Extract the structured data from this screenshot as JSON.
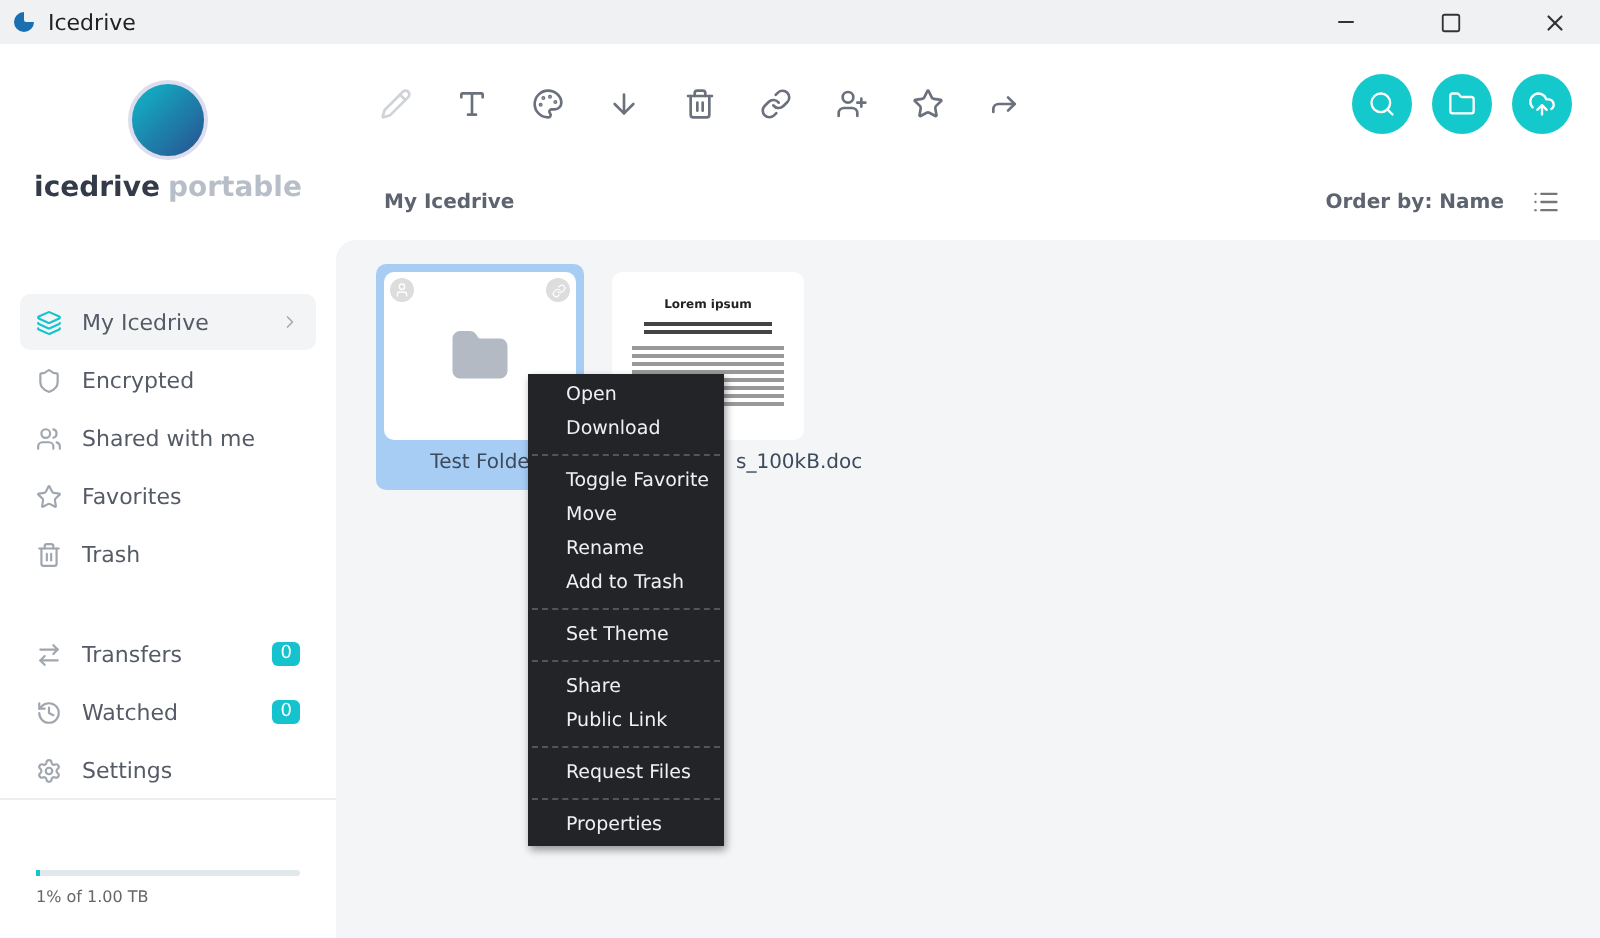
{
  "window": {
    "title": "Icedrive"
  },
  "brand": {
    "name": "icedrive",
    "suffix": "portable"
  },
  "toolbar": {
    "actions": [
      {
        "kind": "edit",
        "disabled": true
      },
      {
        "kind": "font",
        "disabled": false
      },
      {
        "kind": "palette",
        "disabled": false
      },
      {
        "kind": "download",
        "disabled": false
      },
      {
        "kind": "trash",
        "disabled": false
      },
      {
        "kind": "link",
        "disabled": false
      },
      {
        "kind": "adduser",
        "disabled": false
      },
      {
        "kind": "star",
        "disabled": false
      },
      {
        "kind": "share",
        "disabled": false
      }
    ],
    "round_buttons": [
      {
        "kind": "search"
      },
      {
        "kind": "folder"
      },
      {
        "kind": "upload"
      }
    ]
  },
  "breadcrumb": "My Icedrive",
  "order_by": "Order by: Name",
  "sidebar": {
    "items": [
      {
        "label": "My Icedrive",
        "kind": "layers",
        "selected": true
      },
      {
        "label": "Encrypted",
        "kind": "shield",
        "selected": false
      },
      {
        "label": "Shared with me",
        "kind": "users",
        "selected": false
      },
      {
        "label": "Favorites",
        "kind": "star",
        "selected": false
      },
      {
        "label": "Trash",
        "kind": "trash",
        "selected": false
      }
    ],
    "secondary": [
      {
        "label": "Transfers",
        "kind": "transfer",
        "count": "0"
      },
      {
        "label": "Watched",
        "kind": "history",
        "count": "0"
      },
      {
        "label": "Settings",
        "kind": "gear"
      }
    ]
  },
  "storage": {
    "level": 0.01,
    "reading": "1% of 1.00 TB"
  },
  "files": [
    {
      "kind": "folder",
      "name": "Test Folde",
      "selected": true
    },
    {
      "kind": "document",
      "name": "s_100kB.doc",
      "preview_title": "Lorem ipsum",
      "selected": false
    }
  ],
  "context_menu": {
    "groups": [
      [
        "Open",
        "Download"
      ],
      [
        "Toggle Favorite",
        "Move",
        "Rename",
        "Add to Trash"
      ],
      [
        "Set Theme"
      ],
      [
        "Share",
        "Public Link"
      ],
      [
        "Request Files"
      ],
      [
        "Properties"
      ]
    ]
  }
}
